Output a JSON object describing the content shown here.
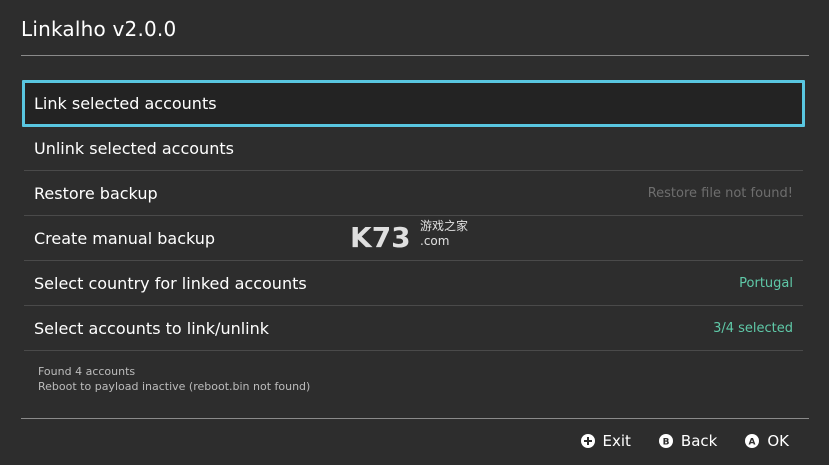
{
  "app": {
    "title": "Linkalho v2.0.0"
  },
  "menu": {
    "items": [
      {
        "label": "Link selected accounts",
        "value": ""
      },
      {
        "label": "Unlink selected accounts",
        "value": ""
      },
      {
        "label": "Restore backup",
        "value": "Restore file not found!"
      },
      {
        "label": "Create manual backup",
        "value": ""
      },
      {
        "label": "Select country for linked accounts",
        "value": "Portugal"
      },
      {
        "label": "Select accounts to link/unlink",
        "value": "3/4 selected"
      }
    ]
  },
  "info": {
    "line1": "Found 4 accounts",
    "line2": "Reboot to payload inactive (reboot.bin not found)"
  },
  "footer": {
    "exit_label": "Exit",
    "back_label": "Back",
    "ok_label": "OK",
    "exit_icon": "plus-button-icon",
    "back_icon": "b-button-icon",
    "ok_icon": "a-button-icon"
  },
  "watermark": {
    "text_main": "K73",
    "text_cn": "游戏之家",
    "text_sub": ".com"
  },
  "colors": {
    "background": "#2d2d2d",
    "selection_border": "#59c6e0",
    "accent_value": "#5fc9a8",
    "muted_value": "#6e6e6e"
  }
}
